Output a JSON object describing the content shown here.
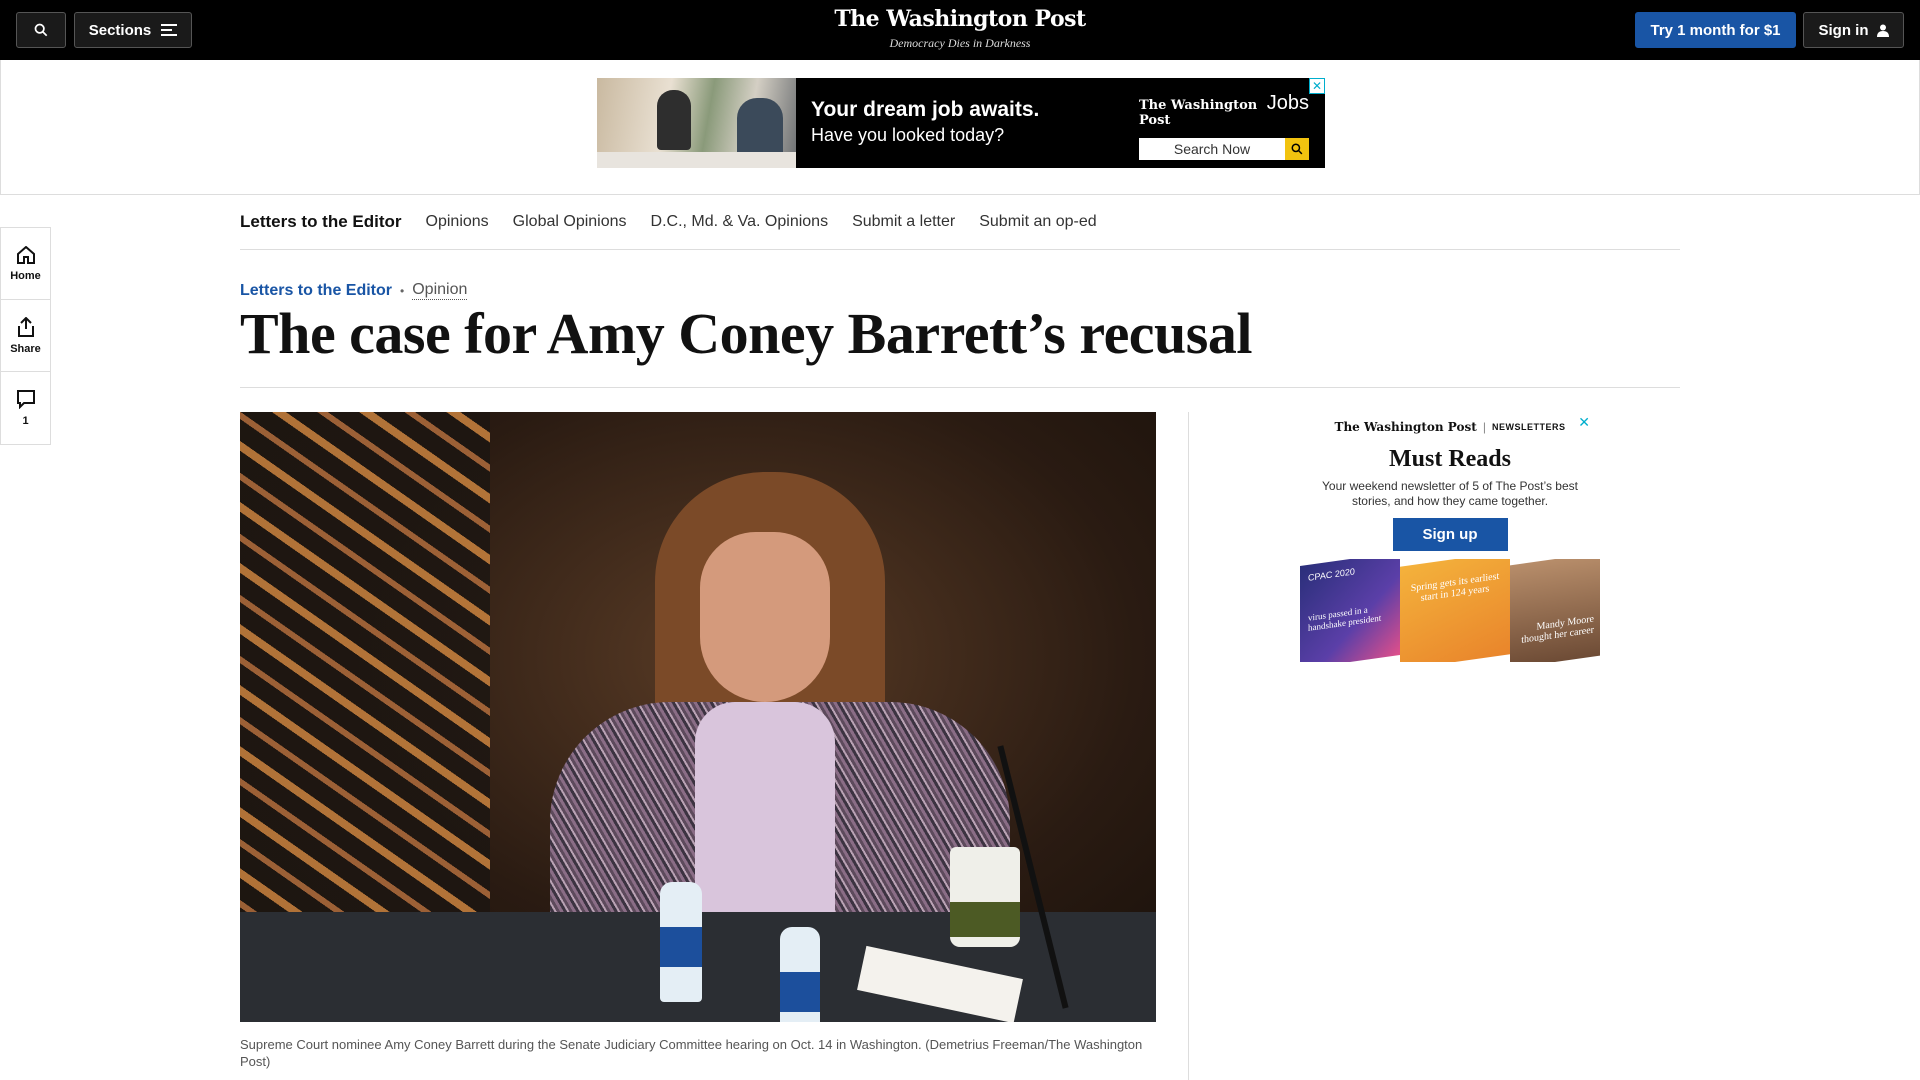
{
  "topbar": {
    "sections_label": "Sections",
    "logo": "The Washington Post",
    "tagline": "Democracy Dies in Darkness",
    "try_label": "Try 1 month for $1",
    "signin_label": "Sign in",
    "icons": {
      "search": "search-icon",
      "menu": "menu-icon",
      "user": "user-icon"
    }
  },
  "jobs_ad": {
    "headline": "Your dream job awaits.",
    "subline": "Have you looked today?",
    "brand": "The Washington Post",
    "brand_suffix": "Jobs",
    "search_label": "Search Now",
    "close_glyph": "✕"
  },
  "rail": {
    "home_label": "Home",
    "share_label": "Share",
    "comments_count": "1"
  },
  "subnav": {
    "items": [
      "Letters to the Editor",
      "Opinions",
      "Global Opinions",
      "D.C., Md. & Va. Opinions",
      "Submit a letter",
      "Submit an op-ed"
    ]
  },
  "article": {
    "section": "Letters to the Editor",
    "dot": "•",
    "label": "Opinion",
    "headline": "The case for Amy Coney Barrett’s recusal",
    "caption": "Supreme Court nominee Amy Coney Barrett during the Senate Judiciary Committee hearing on Oct. 14 in Washington. (Demetrius Freeman/The Washington Post)"
  },
  "newsletter_ad": {
    "brand": "The Washington Post",
    "separator": "|",
    "brand_suffix": "NEWSLETTERS",
    "close_glyph": "✕",
    "title": "Must Reads",
    "subtitle": "Your weekend newsletter of 5 of The Post’s best stories, and how they came together.",
    "button": "Sign up",
    "card1_text": "CPAC 2020",
    "card1_caption": "virus passed in a handshake president",
    "card2_text": "Spring gets its earliest start in 124 years",
    "card3_text": "Mandy Moore thought her career"
  },
  "colors": {
    "brand_blue": "#1955a5",
    "ad_accent": "#00aecd",
    "topbar": "#000000"
  }
}
